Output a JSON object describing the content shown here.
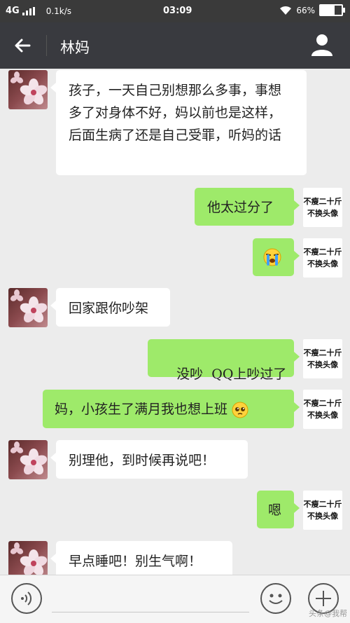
{
  "status_bar": {
    "network": "4G",
    "speed": "0.1k/s",
    "time": "03:09",
    "battery": "66%",
    "battery_level": 0.66
  },
  "header": {
    "title": "林妈",
    "back_icon": "arrow-left-icon",
    "profile_icon": "person-icon"
  },
  "my_avatar_text": {
    "line1": "不瘦二十斤",
    "line2": "不换头像"
  },
  "messages": [
    {
      "side": "in",
      "text": "孩子，一天自己别想那么多事，事想多了对身体不好，妈以前也是这样，后面生病了还是自己受罪，听妈的话"
    },
    {
      "side": "out",
      "text": "他太过分了"
    },
    {
      "side": "out",
      "emoji": "crying-emoji"
    },
    {
      "side": "in",
      "text": "回家跟你吵架"
    },
    {
      "side": "out",
      "text": "没吵  QQ上吵过了"
    },
    {
      "side": "out",
      "text": "妈，小孩生了满月我也想上班",
      "emoji": "pleading-emoji"
    },
    {
      "side": "in",
      "text": "别理他，到时候再说吧！"
    },
    {
      "side": "out",
      "text": "嗯"
    },
    {
      "side": "in",
      "text": "早点睡吧！别生气啊！"
    }
  ],
  "bottom_bar": {
    "voice_icon": "voice-icon",
    "emoji_icon": "smiley-icon",
    "more_icon": "plus-icon",
    "watermark": "头条@我帮"
  },
  "colors": {
    "header_bg": "#393a3f",
    "status_bg": "#3a3a3a",
    "chat_bg": "#ececec",
    "outgoing_bubble": "#9eea6a",
    "incoming_bubble": "#ffffff"
  }
}
